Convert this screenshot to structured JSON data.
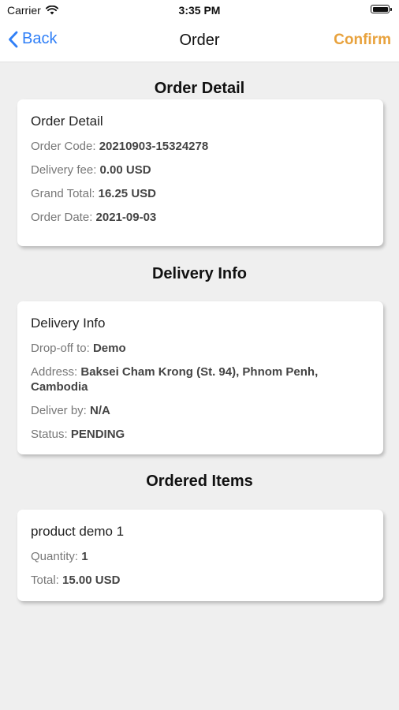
{
  "status_bar": {
    "carrier": "Carrier",
    "time": "3:35 PM"
  },
  "nav": {
    "back_label": "Back",
    "title": "Order",
    "confirm_label": "Confirm"
  },
  "order_detail": {
    "section_title": "Order Detail",
    "card_title": "Order Detail",
    "rows": [
      {
        "label": "Order Code: ",
        "value": "20210903-15324278"
      },
      {
        "label": "Delivery fee: ",
        "value": "0.00 USD"
      },
      {
        "label": "Grand Total: ",
        "value": "16.25 USD"
      },
      {
        "label": "Order Date: ",
        "value": "2021-09-03"
      }
    ]
  },
  "delivery_info": {
    "section_title": "Delivery Info",
    "card_title": "Delivery Info",
    "rows": [
      {
        "label": "Drop-off to: ",
        "value": "Demo"
      },
      {
        "label": "Address: ",
        "value": "Baksei Cham Krong (St. 94), Phnom Penh, Cambodia"
      },
      {
        "label": "Deliver by: ",
        "value": "N/A"
      },
      {
        "label": "Status: ",
        "value": "PENDING"
      }
    ]
  },
  "ordered_items": {
    "section_title": "Ordered Items",
    "items": [
      {
        "name": "product demo 1",
        "rows": [
          {
            "label": "Quantity: ",
            "value": "1"
          },
          {
            "label": "Total: ",
            "value": "15.00 USD"
          }
        ]
      }
    ]
  },
  "colors": {
    "accent_blue": "#2f7ff7",
    "confirm_orange": "#e8a23d",
    "background": "#efefef"
  },
  "icons": [
    "wifi-icon",
    "battery-icon",
    "chevron-left-icon"
  ]
}
